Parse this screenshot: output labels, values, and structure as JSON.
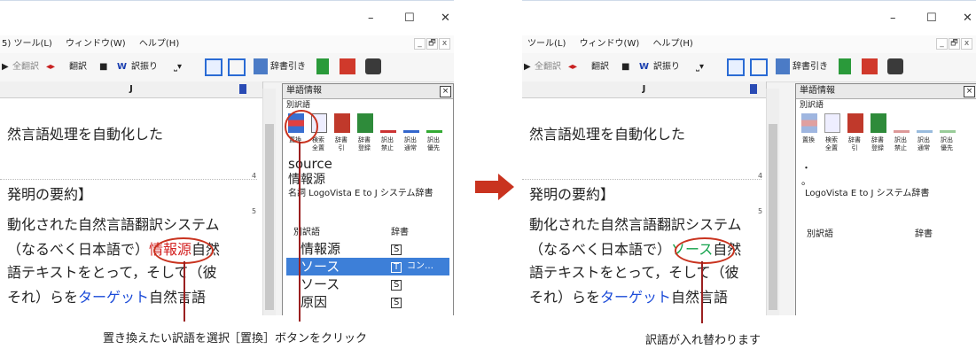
{
  "left_window": {
    "title_buttons": [
      "–",
      "☐",
      "✕"
    ],
    "menu": [
      "5) ツール(L)",
      "ウィンドウ(W)",
      "ヘルプ(H)"
    ],
    "mdi_buttons": [
      "_",
      "🗗",
      "x"
    ],
    "toolbar": {
      "full_translate": "全翻訳",
      "translate": "翻訳",
      "stop": "■",
      "translate_swap": "訳振り",
      "dict_lookup": "辞書引き"
    },
    "doc": {
      "column_header": "J",
      "lines": {
        "l1": "然言語処理を自動化した",
        "l2": "発明の要約】",
        "l3": "動化された自然言語翻訳システム",
        "l4a": "（なるべく日本語で）",
        "l4b": "情報源",
        "l4c": "自然",
        "l5": "語テキストをとって，そして（彼",
        "l6a": "それ）らを",
        "l6b": "ターゲット",
        "l6c": "自然言語"
      },
      "line_numbers": [
        "4",
        "5"
      ]
    },
    "panel": {
      "title": "単語情報",
      "close": "×",
      "sub": "別訳語",
      "buttons": [
        "置換",
        "検索\n全置",
        "辞書引",
        "辞書\n登録",
        "訳出\n禁止",
        "訳出\n通常",
        "訳出\n優先"
      ],
      "headword": "source",
      "translation": "情報源",
      "pos_dict": "名詞 LogoVista E to J システム辞書",
      "table_headers": [
        "別訳語",
        "辞書"
      ],
      "rows": [
        {
          "word": "情報源",
          "dict": "S",
          "extra": ""
        },
        {
          "word": "ソース",
          "dict": "T",
          "extra": "コン…"
        },
        {
          "word": "ソース",
          "dict": "S",
          "extra": ""
        },
        {
          "word": "原因",
          "dict": "S",
          "extra": ""
        }
      ]
    }
  },
  "right_window": {
    "title_buttons": [
      "–",
      "☐",
      "✕"
    ],
    "menu": [
      "ツール(L)",
      "ウィンドウ(W)",
      "ヘルプ(H)"
    ],
    "mdi_buttons": [
      "_",
      "🗗",
      "x"
    ],
    "toolbar": {
      "full_translate": "全翻訳",
      "translate": "翻訳",
      "stop": "■",
      "translate_swap": "訳振り",
      "dict_lookup": "辞書引き"
    },
    "doc": {
      "column_header": "J",
      "lines": {
        "l1": "然言語処理を自動化した",
        "l2": "発明の要約】",
        "l3": "動化された自然言語翻訳システム",
        "l4a": "（なるべく日本語で）",
        "l4b": "ソース",
        "l4c": "自然",
        "l5": "語テキストをとって，そして（彼",
        "l6a": "それ）らを",
        "l6b": "ターゲット",
        "l6c": "自然言語"
      },
      "line_numbers": [
        "4",
        "5"
      ]
    },
    "panel": {
      "title": "単語情報",
      "close": "×",
      "sub": "別訳語",
      "buttons": [
        "置換",
        "検索\n全置",
        "辞書引",
        "辞書\n登録",
        "訳出\n禁止",
        "訳出\n通常",
        "訳出\n優先"
      ],
      "dot1": "・",
      "dot2": "。",
      "dict_label": "LogoVista E to J システム辞書",
      "table_headers": [
        "別訳語",
        "辞書"
      ]
    }
  },
  "captions": {
    "select": "置き換えたい訳語を選択",
    "click": "［置換］ボタンをクリック",
    "result": "訳語が入れ替わります"
  },
  "colors": {
    "accent_red": "#c9331f",
    "highlight_blue": "#3d7fd8",
    "green_text": "#11a24a",
    "blue_text": "#1a4ad8"
  }
}
